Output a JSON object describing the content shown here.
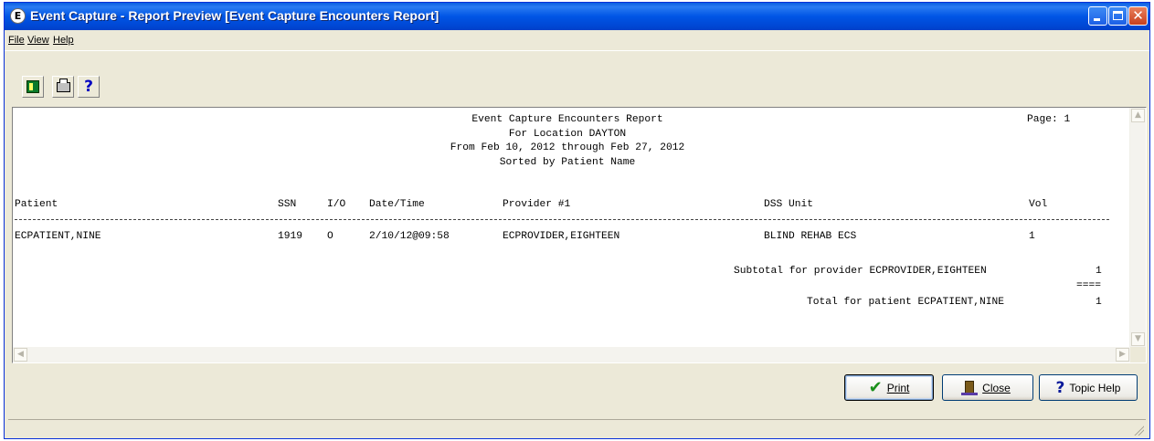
{
  "window": {
    "title": "Event Capture - Report Preview [Event Capture Encounters Report]",
    "app_icon_glyph": "E"
  },
  "menu": {
    "file": "File",
    "view": "View",
    "help": "Help"
  },
  "toolbar": {
    "exit_icon": "exit-door-icon",
    "print_icon": "printer-icon",
    "help_label": "?"
  },
  "report": {
    "title": "Event Capture Encounters Report",
    "location": "For Location DAYTON",
    "date_range": "From Feb 10, 2012 through Feb 27, 2012",
    "sort": "Sorted by Patient Name",
    "page_label": "Page: 1",
    "columns": {
      "patient": "Patient",
      "ssn": "SSN",
      "io": "I/O",
      "datetime": "Date/Time",
      "provider": "Provider #1",
      "dss_unit": "DSS Unit",
      "vol": "Vol"
    },
    "rows": [
      {
        "patient": "ECPATIENT,NINE",
        "ssn": "1919",
        "io": "O",
        "datetime": "2/10/12@09:58",
        "provider": "ECPROVIDER,EIGHTEEN",
        "dss_unit": "BLIND REHAB ECS",
        "vol": "1"
      }
    ],
    "subtotal_label": "Subtotal for provider ECPROVIDER,EIGHTEEN",
    "subtotal_value": "1",
    "separator": "====",
    "total_label": "Total for patient ECPATIENT,NINE",
    "total_value": "1"
  },
  "buttons": {
    "print": "Print",
    "close": "Close",
    "topic_help": "Topic Help"
  },
  "colors": {
    "titlebar": "#0055e5",
    "face": "#ece9d8",
    "close_button": "#c8401e"
  }
}
